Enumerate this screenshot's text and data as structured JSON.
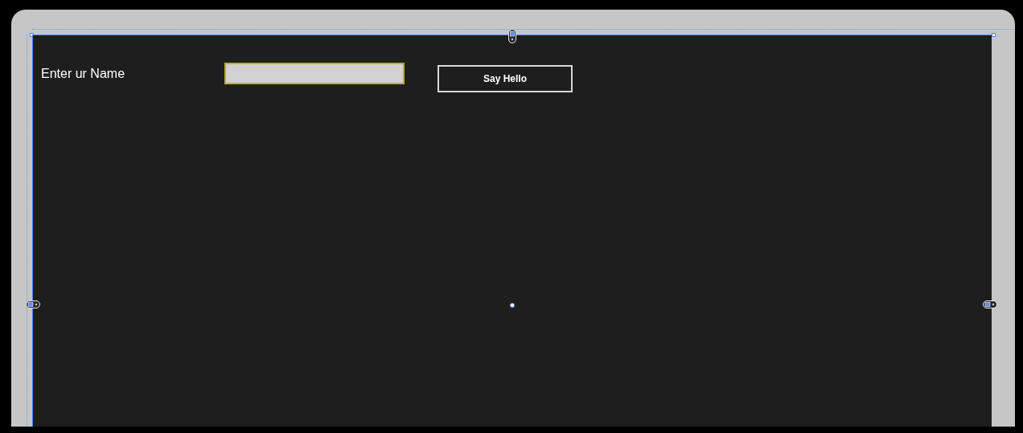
{
  "form": {
    "label": "Enter ur Name",
    "name_field": {
      "selected": true
    },
    "button": "Say Hello"
  }
}
